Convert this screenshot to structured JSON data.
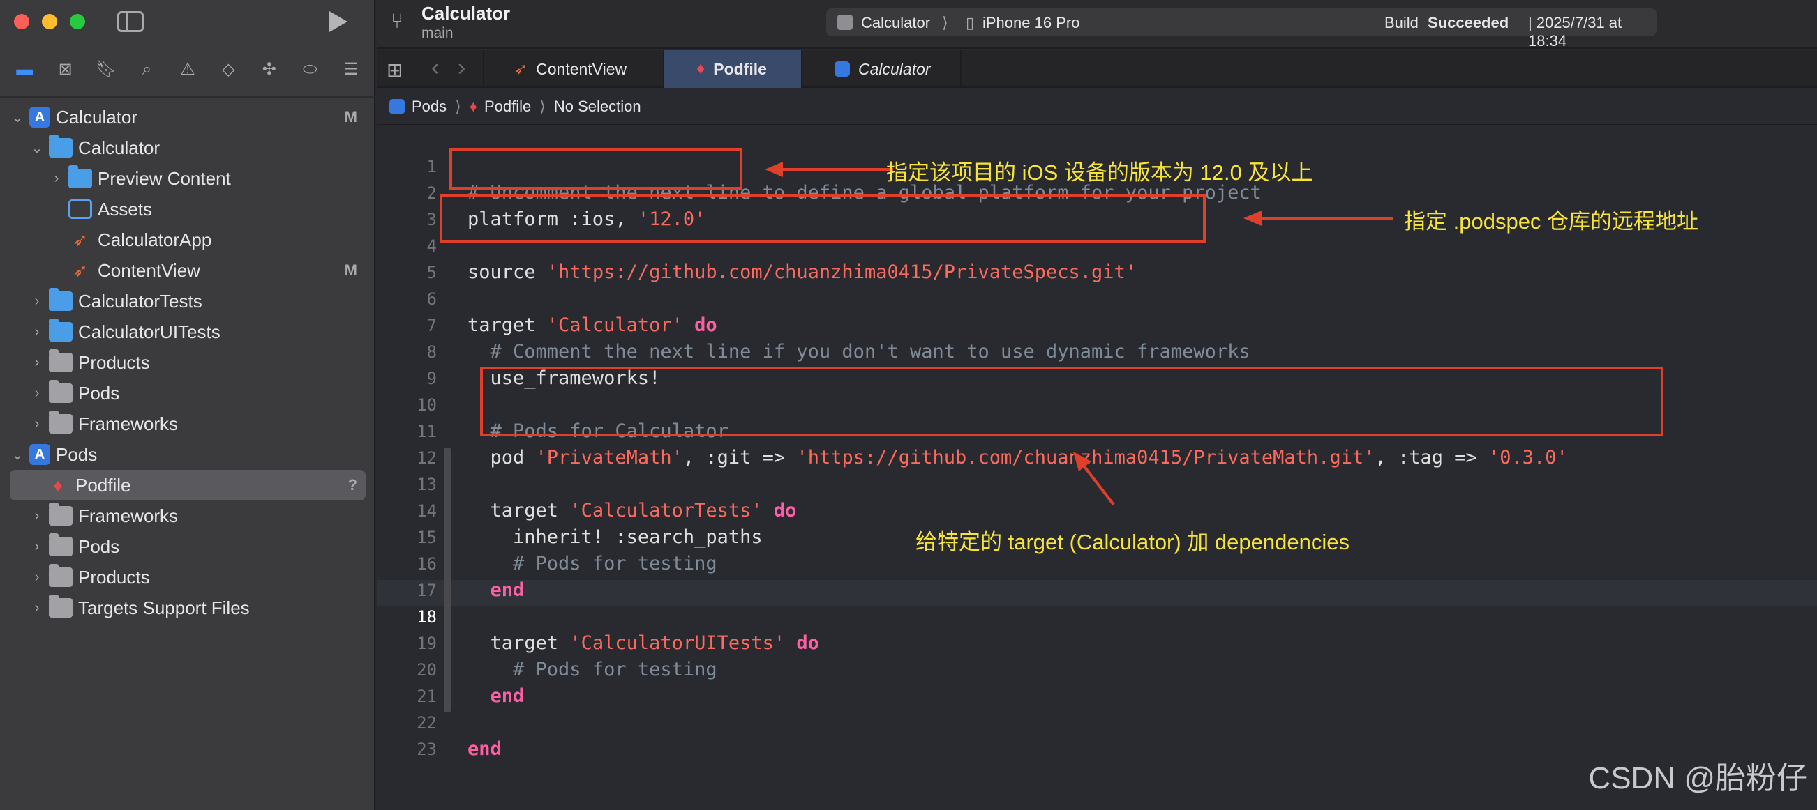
{
  "window": {
    "title": "Calculator",
    "branch": "main",
    "scheme": "Calculator",
    "scheme_sep": "⟩",
    "device": "iPhone 16 Pro",
    "build_status_prefix": "Build",
    "build_status": "Succeeded",
    "build_time": "| 2025/7/31 at 18:34"
  },
  "colors": {
    "close": "#fe5f57",
    "minimize": "#febc2e",
    "zoom": "#28c840",
    "accent": "#3e8ef7",
    "annotation": "#e0402a",
    "annotation_text": "#f7e43a"
  },
  "navigator_icons": [
    "folder-icon",
    "source-control-icon",
    "bookmark-icon",
    "find-icon",
    "issue-icon",
    "test-icon",
    "debug-icon",
    "breakpoint-icon",
    "report-icon"
  ],
  "tree": [
    {
      "label": "Calculator",
      "badge": "M"
    },
    {
      "label": "Calculator",
      "badge": ""
    },
    {
      "label": "Preview Content",
      "badge": ""
    },
    {
      "label": "Assets",
      "badge": ""
    },
    {
      "label": "CalculatorApp",
      "badge": ""
    },
    {
      "label": "ContentView",
      "badge": "M"
    },
    {
      "label": "CalculatorTests",
      "badge": ""
    },
    {
      "label": "CalculatorUITests",
      "badge": ""
    },
    {
      "label": "Products",
      "badge": ""
    },
    {
      "label": "Pods",
      "badge": ""
    },
    {
      "label": "Frameworks",
      "badge": ""
    },
    {
      "label": "Pods",
      "badge": ""
    },
    {
      "label": "Podfile",
      "badge": "?"
    },
    {
      "label": "Frameworks",
      "badge": ""
    },
    {
      "label": "Pods",
      "badge": ""
    },
    {
      "label": "Products",
      "badge": ""
    },
    {
      "label": "Targets Support Files",
      "badge": ""
    }
  ],
  "tabs": [
    {
      "label": "ContentView"
    },
    {
      "label": "Podfile"
    },
    {
      "label": "Calculator"
    }
  ],
  "breadcrumb": {
    "items": [
      "Pods",
      "Podfile",
      "No Selection"
    ],
    "sep": "⟩"
  },
  "editor": {
    "line_numbers": [
      "1",
      "2",
      "3",
      "4",
      "5",
      "6",
      "7",
      "8",
      "9",
      "10",
      "11",
      "12",
      "13",
      "14",
      "15",
      "16",
      "17",
      "18",
      "19",
      "20",
      "21",
      "22",
      "23"
    ],
    "current_line": "18",
    "code": {
      "l1": "# Uncomment the next line to define a global platform for your project",
      "l2a": "platform :ios, ",
      "l2b": "'12.0'",
      "l4a": "source ",
      "l4b": "'https://github.com/chuanzhima0415/PrivateSpecs.git'",
      "l6a": "target ",
      "l6b": "'Calculator'",
      "l6c": " do",
      "l7": "  # Comment the next line if you don't want to use dynamic frameworks",
      "l8": "  use_frameworks!",
      "l10": "  # Pods for Calculator",
      "l11a": "  pod ",
      "l11b": "'PrivateMath'",
      "l11c": ", :git => ",
      "l11d": "'https://github.com/chuanzhima0415/PrivateMath.git'",
      "l11e": ", :tag => ",
      "l11f": "'0.3.0'",
      "l13a": "  target ",
      "l13b": "'CalculatorTests'",
      "l13c": " do",
      "l14": "    inherit! :search_paths",
      "l15": "    # Pods for testing",
      "l16": "  end",
      "l18a": "  target ",
      "l18b": "'CalculatorUITests'",
      "l18c": " do",
      "l19": "    # Pods for testing",
      "l20": "  end",
      "l22": "end"
    }
  },
  "annotations": {
    "a1": "指定该项目的 iOS 设备的版本为 12.0 及以上",
    "a2": "指定 .podspec 仓库的远程地址",
    "a3": "给特定的 target (Calculator) 加 dependencies"
  },
  "watermark": "CSDN @胎粉仔"
}
